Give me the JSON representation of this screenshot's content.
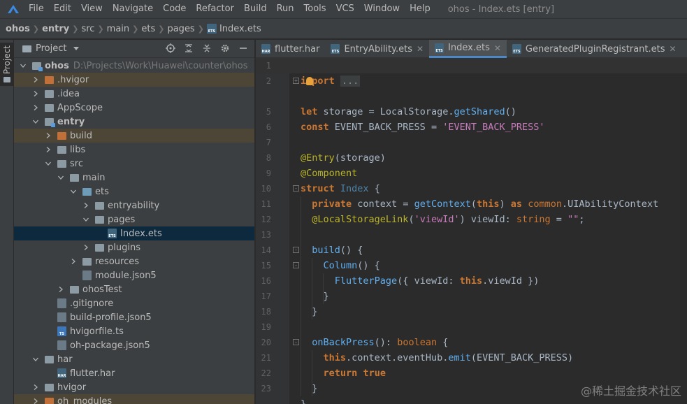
{
  "menubar": {
    "items": [
      "File",
      "Edit",
      "View",
      "Navigate",
      "Code",
      "Refactor",
      "Build",
      "Run",
      "Tools",
      "VCS",
      "Window",
      "Help"
    ],
    "window_title": "ohos - Index.ets [entry]"
  },
  "breadcrumb": [
    "ohos",
    "entry",
    "src",
    "main",
    "ets",
    "pages",
    "Index.ets"
  ],
  "strip": {
    "project_tab": "Project"
  },
  "project_panel": {
    "title": "Project",
    "tree": [
      {
        "label": "ohos",
        "path": "D:\\Projects\\Work\\Huawei\\counter\\ohos",
        "depth": 0,
        "expanded": true,
        "kind": "folder-module",
        "bold": true
      },
      {
        "label": ".hvigor",
        "depth": 1,
        "expanded": false,
        "kind": "folder-orange",
        "excluded": true
      },
      {
        "label": ".idea",
        "depth": 1,
        "expanded": false,
        "kind": "folder-grey"
      },
      {
        "label": "AppScope",
        "depth": 1,
        "expanded": false,
        "kind": "folder-grey"
      },
      {
        "label": "entry",
        "depth": 1,
        "expanded": true,
        "kind": "folder-module",
        "bold": true
      },
      {
        "label": "build",
        "depth": 2,
        "expanded": false,
        "kind": "folder-orange",
        "excluded": true
      },
      {
        "label": "libs",
        "depth": 2,
        "expanded": false,
        "kind": "folder-grey"
      },
      {
        "label": "src",
        "depth": 2,
        "expanded": true,
        "kind": "folder-grey"
      },
      {
        "label": "main",
        "depth": 3,
        "expanded": true,
        "kind": "folder-grey"
      },
      {
        "label": "ets",
        "depth": 4,
        "expanded": true,
        "kind": "folder-blue"
      },
      {
        "label": "entryability",
        "depth": 5,
        "expanded": false,
        "kind": "folder-grey"
      },
      {
        "label": "pages",
        "depth": 5,
        "expanded": true,
        "kind": "folder-grey"
      },
      {
        "label": "Index.ets",
        "depth": 6,
        "kind": "file-ets",
        "selected": true
      },
      {
        "label": "plugins",
        "depth": 5,
        "expanded": false,
        "kind": "folder-grey"
      },
      {
        "label": "resources",
        "depth": 4,
        "expanded": false,
        "kind": "folder-grey"
      },
      {
        "label": "module.json5",
        "depth": 4,
        "kind": "file-json"
      },
      {
        "label": "ohosTest",
        "depth": 3,
        "expanded": false,
        "kind": "folder-grey"
      },
      {
        "label": ".gitignore",
        "depth": 2,
        "kind": "file-git"
      },
      {
        "label": "build-profile.json5",
        "depth": 2,
        "kind": "file-json"
      },
      {
        "label": "hvigorfile.ts",
        "depth": 2,
        "kind": "file-ts"
      },
      {
        "label": "oh-package.json5",
        "depth": 2,
        "kind": "file-json"
      },
      {
        "label": "har",
        "depth": 1,
        "expanded": true,
        "kind": "folder-grey"
      },
      {
        "label": "flutter.har",
        "depth": 2,
        "kind": "file-har"
      },
      {
        "label": "hvigor",
        "depth": 1,
        "expanded": false,
        "kind": "folder-grey"
      },
      {
        "label": "oh_modules",
        "depth": 1,
        "expanded": false,
        "kind": "folder-orange",
        "excluded": true
      }
    ]
  },
  "editor_tabs": [
    {
      "label": "flutter.har",
      "icon": "har",
      "active": false,
      "closable": false
    },
    {
      "label": "EntryAbility.ets",
      "icon": "ets",
      "active": false,
      "closable": true
    },
    {
      "label": "Index.ets",
      "icon": "ets",
      "active": true,
      "closable": true
    },
    {
      "label": "GeneratedPluginRegistrant.ets",
      "icon": "ets",
      "active": false,
      "closable": true
    }
  ],
  "editor": {
    "lines": [
      {
        "n": "1",
        "tokens": []
      },
      {
        "n": "2",
        "tokens": [
          {
            "t": "import",
            "c": "kw"
          },
          {
            "t": " "
          },
          {
            "t": "...",
            "c": "ellipsis"
          }
        ]
      },
      {
        "n": "",
        "tokens": []
      },
      {
        "n": "5",
        "tokens": [
          {
            "t": "let",
            "c": "kw"
          },
          {
            "t": " storage = LocalStorage."
          },
          {
            "t": "getShared",
            "c": "fn"
          },
          {
            "t": "()"
          }
        ]
      },
      {
        "n": "6",
        "tokens": [
          {
            "t": "const",
            "c": "kw"
          },
          {
            "t": " EVENT_BACK_PRESS = "
          },
          {
            "t": "'EVENT_BACK_PRESS'",
            "c": "str2"
          }
        ]
      },
      {
        "n": "7",
        "tokens": []
      },
      {
        "n": "8",
        "tokens": [
          {
            "t": "@Entry",
            "c": "ann"
          },
          {
            "t": "(storage)"
          }
        ]
      },
      {
        "n": "9",
        "tokens": [
          {
            "t": "@Component",
            "c": "ann"
          }
        ]
      },
      {
        "n": "10",
        "tokens": [
          {
            "t": "struct",
            "c": "kw"
          },
          {
            "t": " "
          },
          {
            "t": "Index",
            "c": "cls"
          },
          {
            "t": " {"
          }
        ]
      },
      {
        "n": "11",
        "tokens": [
          {
            "t": "  "
          },
          {
            "t": "private",
            "c": "kw"
          },
          {
            "t": " context = "
          },
          {
            "t": "getContext",
            "c": "fn"
          },
          {
            "t": "("
          },
          {
            "t": "this",
            "c": "kw"
          },
          {
            "t": ") "
          },
          {
            "t": "as",
            "c": "kw"
          },
          {
            "t": " "
          },
          {
            "t": "common",
            "c": "kw2"
          },
          {
            "t": ".UIAbilityContext"
          }
        ]
      },
      {
        "n": "12",
        "tokens": [
          {
            "t": "  "
          },
          {
            "t": "@LocalStorageLink",
            "c": "ann"
          },
          {
            "t": "("
          },
          {
            "t": "'viewId'",
            "c": "str2"
          },
          {
            "t": ") viewId: "
          },
          {
            "t": "string",
            "c": "kw2"
          },
          {
            "t": " = "
          },
          {
            "t": "\"\"",
            "c": "str2"
          },
          {
            "t": ";"
          }
        ]
      },
      {
        "n": "13",
        "tokens": []
      },
      {
        "n": "14",
        "tokens": [
          {
            "t": "  "
          },
          {
            "t": "build",
            "c": "fn"
          },
          {
            "t": "() {"
          }
        ]
      },
      {
        "n": "15",
        "tokens": [
          {
            "t": "    "
          },
          {
            "t": "Column",
            "c": "fn"
          },
          {
            "t": "() {"
          }
        ]
      },
      {
        "n": "16",
        "tokens": [
          {
            "t": "      "
          },
          {
            "t": "FlutterPage",
            "c": "fn"
          },
          {
            "t": "({ viewId: "
          },
          {
            "t": "this",
            "c": "kw"
          },
          {
            "t": ".viewId })"
          }
        ]
      },
      {
        "n": "17",
        "tokens": [
          {
            "t": "    }"
          }
        ]
      },
      {
        "n": "18",
        "tokens": [
          {
            "t": "  }"
          }
        ]
      },
      {
        "n": "19",
        "tokens": []
      },
      {
        "n": "20",
        "tokens": [
          {
            "t": "  "
          },
          {
            "t": "onBackPress",
            "c": "fn"
          },
          {
            "t": "(): "
          },
          {
            "t": "boolean",
            "c": "kw2"
          },
          {
            "t": " {"
          }
        ]
      },
      {
        "n": "21",
        "tokens": [
          {
            "t": "    "
          },
          {
            "t": "this",
            "c": "kw"
          },
          {
            "t": ".context.eventHub."
          },
          {
            "t": "emit",
            "c": "fn"
          },
          {
            "t": "(EVENT_BACK_PRESS)"
          }
        ]
      },
      {
        "n": "22",
        "tokens": [
          {
            "t": "    "
          },
          {
            "t": "return",
            "c": "kw"
          },
          {
            "t": " "
          },
          {
            "t": "true",
            "c": "kw"
          }
        ]
      },
      {
        "n": "23",
        "tokens": [
          {
            "t": "  }"
          }
        ]
      },
      {
        "n": "",
        "tokens": [
          {
            "t": "}"
          }
        ]
      }
    ],
    "watermark": "@稀土掘金技术社区"
  }
}
